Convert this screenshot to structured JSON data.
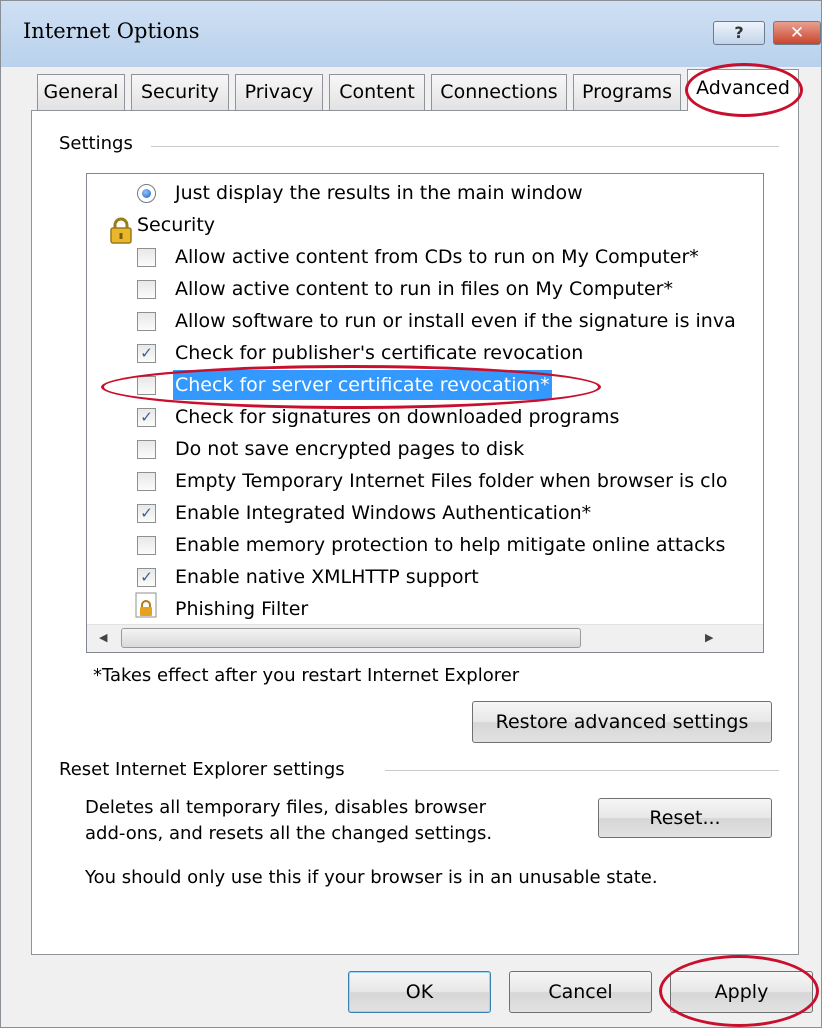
{
  "window": {
    "title": "Internet Options",
    "help_glyph": "?",
    "close_glyph": "✕"
  },
  "tabs": [
    {
      "label": "General"
    },
    {
      "label": "Security"
    },
    {
      "label": "Privacy"
    },
    {
      "label": "Content"
    },
    {
      "label": "Connections"
    },
    {
      "label": "Programs"
    },
    {
      "label": "Advanced",
      "active": true
    }
  ],
  "settings": {
    "group_label": "Settings",
    "items": [
      {
        "type": "radio",
        "label": "Just display the results in the main window",
        "checked": true
      },
      {
        "type": "category",
        "label": "Security",
        "icon": "lock-icon"
      },
      {
        "type": "checkbox",
        "label": "Allow active content from CDs to run on My Computer*",
        "checked": false
      },
      {
        "type": "checkbox",
        "label": "Allow active content to run in files on My Computer*",
        "checked": false
      },
      {
        "type": "checkbox",
        "label": "Allow software to run or install even if the signature is inva",
        "checked": false
      },
      {
        "type": "checkbox",
        "label": "Check for publisher's certificate revocation",
        "checked": true
      },
      {
        "type": "checkbox",
        "label": "Check for server certificate revocation*",
        "checked": false,
        "selected": true
      },
      {
        "type": "checkbox",
        "label": "Check for signatures on downloaded programs",
        "checked": true
      },
      {
        "type": "checkbox",
        "label": "Do not save encrypted pages to disk",
        "checked": false
      },
      {
        "type": "checkbox",
        "label": "Empty Temporary Internet Files folder when browser is clo",
        "checked": false
      },
      {
        "type": "checkbox",
        "label": "Enable Integrated Windows Authentication*",
        "checked": true
      },
      {
        "type": "checkbox",
        "label": "Enable memory protection to help mitigate online attacks",
        "checked": false
      },
      {
        "type": "checkbox",
        "label": "Enable native XMLHTTP support",
        "checked": true
      },
      {
        "type": "category",
        "label": "Phishing Filter",
        "icon": "phishing-filter-icon"
      }
    ],
    "restart_note": "*Takes effect after you restart Internet Explorer",
    "restore_button": "Restore advanced settings"
  },
  "reset": {
    "group_label": "Reset Internet Explorer settings",
    "description_line1": "Deletes all temporary files, disables browser",
    "description_line2": "add-ons, and resets all the changed settings.",
    "warning": "You should only use this if your browser is in an unusable state.",
    "reset_button": "Reset..."
  },
  "footer": {
    "ok": "OK",
    "cancel": "Cancel",
    "apply": "Apply"
  },
  "colors": {
    "selection": "#3399ff",
    "annotation": "#c8102e",
    "titlebar": "#c4d8ef"
  }
}
